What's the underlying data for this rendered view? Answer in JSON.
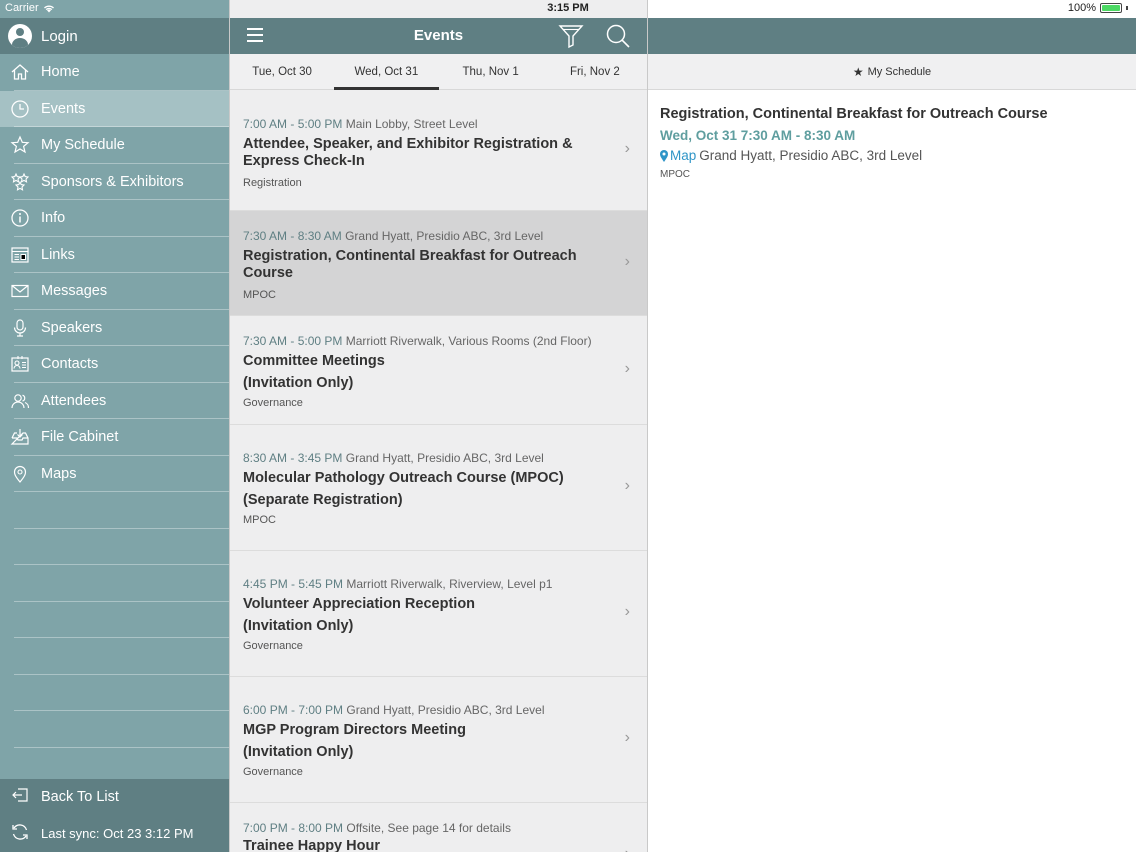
{
  "status": {
    "carrier": "Carrier",
    "time": "3:15 PM",
    "battery": "100%"
  },
  "sidebar": {
    "login": "Login",
    "items": [
      {
        "label": "Home"
      },
      {
        "label": "Events"
      },
      {
        "label": "My Schedule"
      },
      {
        "label": "Sponsors & Exhibitors"
      },
      {
        "label": "Info"
      },
      {
        "label": "Links"
      },
      {
        "label": "Messages"
      },
      {
        "label": "Speakers"
      },
      {
        "label": "Contacts"
      },
      {
        "label": "Attendees"
      },
      {
        "label": "File Cabinet"
      },
      {
        "label": "Maps"
      }
    ],
    "back_to_list": "Back To List",
    "last_sync": "Last sync:  Oct 23 3:12 PM"
  },
  "list": {
    "title": "Events",
    "days": [
      "Tue, Oct 30",
      "Wed, Oct 31",
      "Thu, Nov 1",
      "Fri, Nov 2"
    ],
    "events": [
      {
        "time": "7:00 AM - 5:00 PM",
        "location": "Main Lobby, Street Level",
        "name": "Attendee, Speaker, and Exhibitor Registration & Express Check-In",
        "category": "Registration"
      },
      {
        "time": "7:30 AM - 8:30 AM",
        "location": "Grand Hyatt, Presidio ABC, 3rd Level",
        "name": "Registration, Continental Breakfast for Outreach Course",
        "category": "MPOC"
      },
      {
        "time": "7:30 AM - 5:00 PM",
        "location": "Marriott Riverwalk, Various Rooms (2nd Floor)",
        "name": "Committee Meetings",
        "name2": "(Invitation Only)",
        "category": "Governance"
      },
      {
        "time": "8:30 AM - 3:45 PM",
        "location": "Grand Hyatt, Presidio ABC, 3rd Level",
        "name": "Molecular Pathology Outreach Course (MPOC)",
        "name2": "(Separate Registration)",
        "category": "MPOC"
      },
      {
        "time": "4:45 PM - 5:45 PM",
        "location": "Marriott Riverwalk, Riverview, Level p1",
        "name": "Volunteer Appreciation Reception",
        "name2": "(Invitation Only)",
        "category": "Governance"
      },
      {
        "time": "6:00 PM - 7:00 PM",
        "location": "Grand Hyatt, Presidio ABC, 3rd Level",
        "name": "MGP Program Directors Meeting",
        "name2": "(Invitation Only)",
        "category": "Governance"
      },
      {
        "time": "7:00 PM - 8:00 PM",
        "location": "Offsite, See page 14 for details",
        "name": "Trainee Happy Hour",
        "category": ""
      }
    ]
  },
  "detail": {
    "my_schedule": "My Schedule",
    "title": "Registration, Continental Breakfast for Outreach Course",
    "when": "Wed, Oct 31 7:30 AM - 8:30 AM",
    "map_label": "Map",
    "location": "Grand Hyatt, Presidio ABC, 3rd Level",
    "category": "MPOC"
  },
  "colors": {
    "accent": "#5f7f83",
    "sidebar": "#7fa4a8",
    "active": "#a5c1c4",
    "link": "#2f95c7"
  }
}
